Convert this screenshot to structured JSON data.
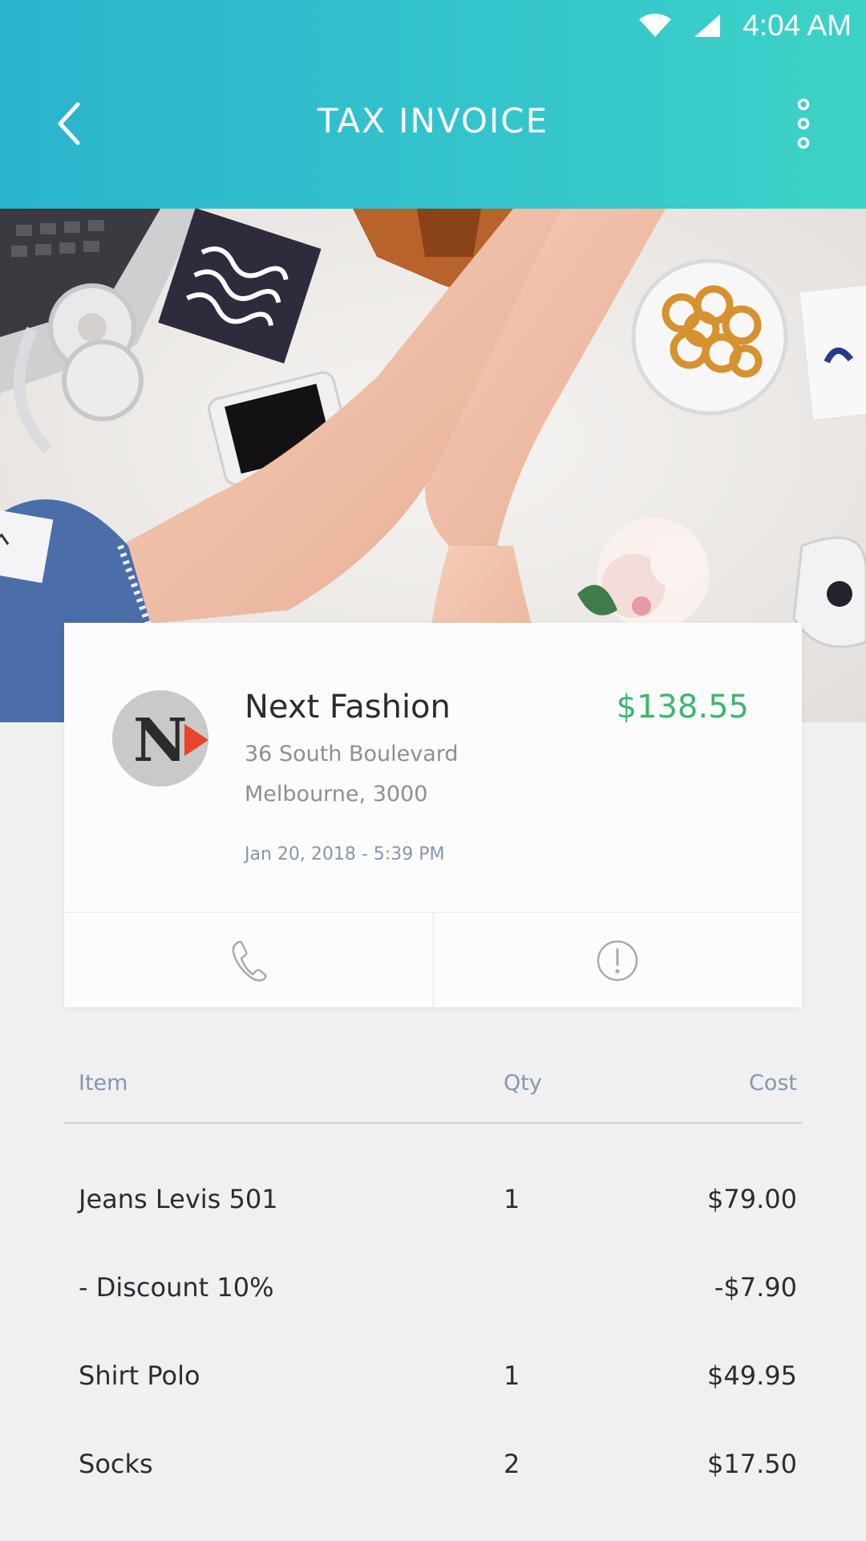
{
  "status_bar": {
    "time": "4:04 AM"
  },
  "header": {
    "title": "TAX INVOICE"
  },
  "merchant": {
    "name": "Next Fashion",
    "total": "$138.55",
    "address_line1": "36 South Boulevard",
    "address_line2": "Melbourne, 3000",
    "datetime": "Jan 20, 2018 - 5:39 PM",
    "logo_letter": "N"
  },
  "colors": {
    "header_gradient_start": "#2ab4cd",
    "header_gradient_end": "#3dd2c6",
    "total_green": "#3fb56e",
    "label_blue_grey": "#8596ad",
    "logo_accent": "#e8432b"
  },
  "icons": {
    "back": "chevron-left-icon",
    "more": "more-vertical-icon",
    "call": "phone-icon",
    "report": "alert-circle-icon"
  },
  "table": {
    "headers": {
      "item": "Item",
      "qty": "Qty",
      "cost": "Cost"
    },
    "rows": [
      {
        "item": "Jeans Levis 501",
        "qty": "1",
        "cost": "$79.00"
      },
      {
        "item": "- Discount 10%",
        "qty": "",
        "cost": "-$7.90"
      },
      {
        "item": "Shirt Polo",
        "qty": "1",
        "cost": "$49.95"
      },
      {
        "item": "Socks",
        "qty": "2",
        "cost": "$17.50"
      }
    ]
  }
}
